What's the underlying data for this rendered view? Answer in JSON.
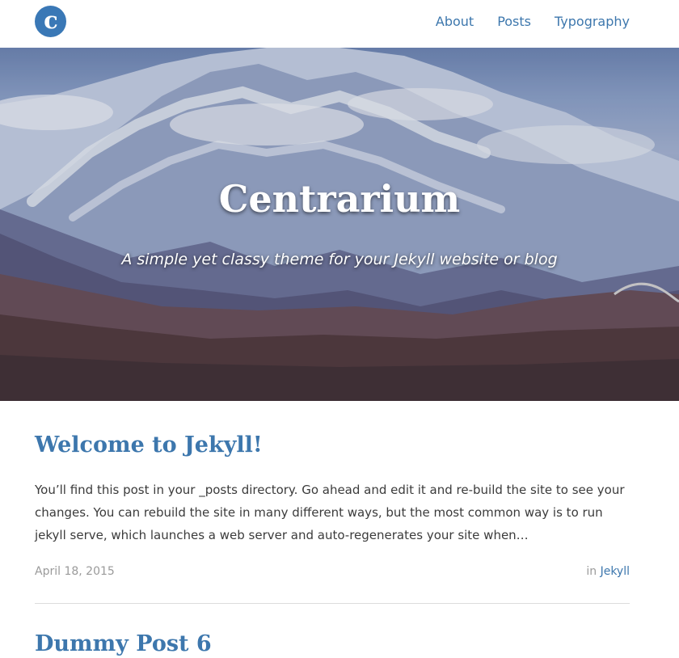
{
  "header": {
    "logo_letter": "c",
    "nav": [
      {
        "label": "About"
      },
      {
        "label": "Posts"
      },
      {
        "label": "Typography"
      }
    ]
  },
  "hero": {
    "title": "Centrarium",
    "subtitle": "A simple yet classy theme for your Jekyll website or blog"
  },
  "posts": [
    {
      "title": "Welcome to Jekyll!",
      "excerpt": "You’ll find this post in your _posts directory. Go ahead and edit it and re-build the site to see your changes. You can rebuild the site in many different ways, but the most common way is to run jekyll serve, which launches a web server and auto-regenerates your site when…",
      "date": "April 18, 2015",
      "category_prefix": "in",
      "category": "Jekyll"
    },
    {
      "title": "Dummy Post 6"
    }
  ],
  "colors": {
    "accent": "#3d77ad",
    "logo_bg": "#3a78b6",
    "text": "#3b3b3b",
    "meta": "#9a9a9a"
  }
}
